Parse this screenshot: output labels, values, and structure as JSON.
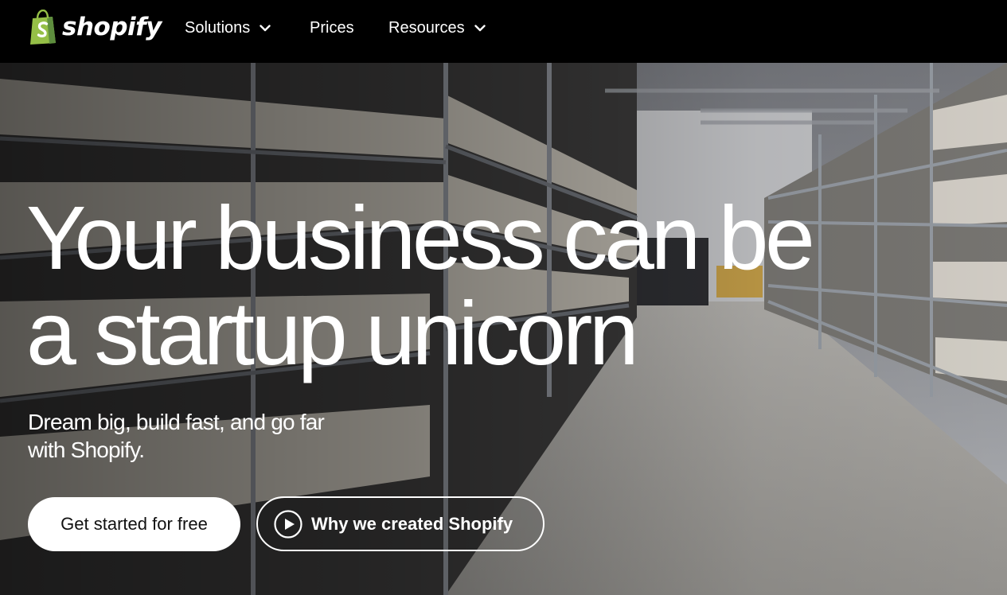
{
  "brand": {
    "name": "shopify",
    "logo_icon": "shopping-bag-icon",
    "logo_color": "#95bf47"
  },
  "nav": {
    "items": [
      {
        "label": "Solutions",
        "has_dropdown": true
      },
      {
        "label": "Prices",
        "has_dropdown": false
      },
      {
        "label": "Resources",
        "has_dropdown": true
      }
    ]
  },
  "hero": {
    "headline_line1": "Your business can be",
    "headline_line2": "a startup unicorn",
    "subtitle": "Dream big, build fast, and go far with Shopify.",
    "primary_cta": "Get started for free",
    "secondary_cta": "Why we created Shopify",
    "secondary_cta_icon": "play-icon",
    "background": "warehouse-aisle-photo"
  },
  "colors": {
    "nav_bg": "#000000",
    "text": "#ffffff",
    "primary_button_bg": "#ffffff",
    "primary_button_text": "#111111"
  }
}
